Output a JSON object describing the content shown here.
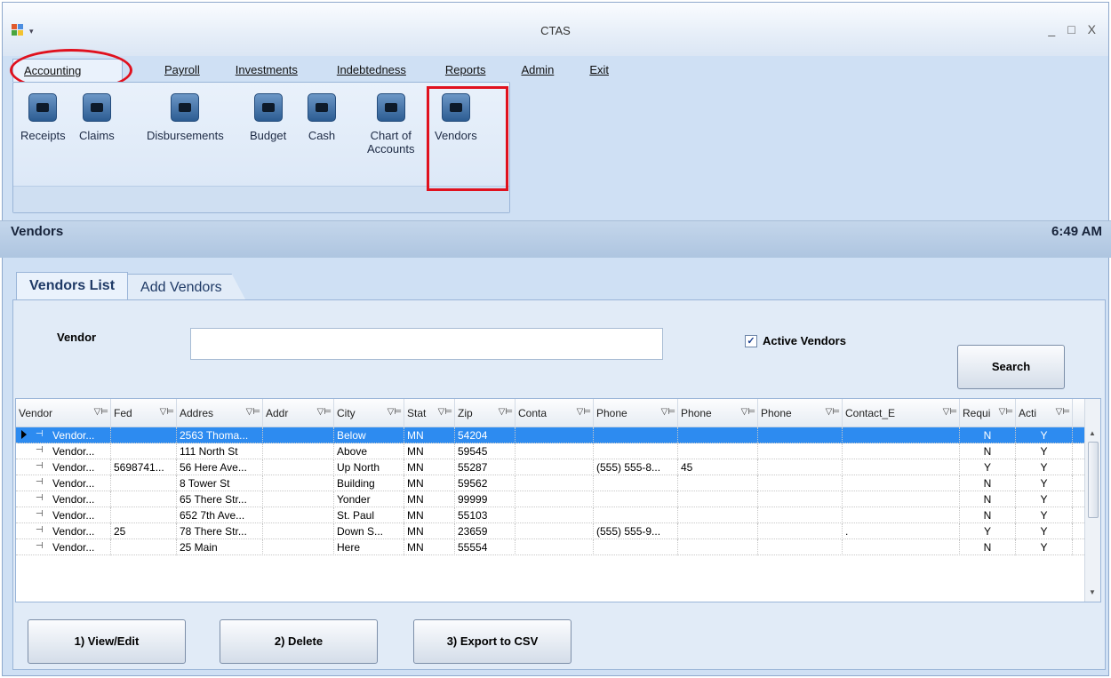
{
  "window": {
    "title": "CTAS",
    "controls": [
      "_",
      "□",
      "X"
    ]
  },
  "menu": [
    {
      "label": "Accounting",
      "active": true
    },
    {
      "label": "Payroll"
    },
    {
      "label": "Investments"
    },
    {
      "label": "Indebtedness"
    },
    {
      "label": "Reports"
    },
    {
      "label": "Admin"
    },
    {
      "label": "Exit"
    }
  ],
  "ribbon": {
    "buttons": [
      {
        "label": "Receipts",
        "icon": "receipts-icon"
      },
      {
        "label": "Claims",
        "icon": "claims-icon"
      },
      {
        "label": "Disbursements",
        "icon": "disbursements-icon"
      },
      {
        "label": "Budget",
        "icon": "budget-icon"
      },
      {
        "label": "Cash",
        "icon": "cash-icon"
      },
      {
        "label": "Chart of",
        "label2": "Accounts",
        "icon": "chart-of-accounts-icon"
      },
      {
        "label": "Vendors",
        "icon": "vendors-icon"
      }
    ]
  },
  "section": {
    "title": "Vendors",
    "time": "6:49 AM"
  },
  "tabs": [
    {
      "label": "Vendors List",
      "active": true
    },
    {
      "label": "Add Vendors"
    }
  ],
  "search": {
    "vendor_label": "Vendor",
    "vendor_value": "",
    "active_label": "Active Vendors",
    "active_checked": true,
    "check_mark": "✓",
    "search_button": "Search"
  },
  "grid": {
    "columns": [
      "Vendor",
      "Fed",
      "Addres",
      "Addr",
      "City",
      "Stat",
      "Zip",
      "Conta",
      "Phone",
      "Phone",
      "Phone",
      "Contact_E",
      "Requi",
      "Acti"
    ],
    "rows": [
      [
        "Vendor...",
        "",
        "2563 Thoma...",
        "",
        "Below",
        "MN",
        "54204",
        "",
        "",
        "",
        "",
        "",
        "N",
        "Y"
      ],
      [
        "Vendor...",
        "",
        "111 North St",
        "",
        "Above",
        "MN",
        "59545",
        "",
        "",
        "",
        "",
        "",
        "N",
        "Y"
      ],
      [
        "Vendor...",
        "5698741...",
        "56 Here Ave...",
        "",
        "Up North",
        "MN",
        "55287",
        "",
        "(555) 555-8...",
        "45",
        "",
        "",
        "Y",
        "Y"
      ],
      [
        "Vendor...",
        "",
        "8 Tower St",
        "",
        "Building",
        "MN",
        "59562",
        "",
        "",
        "",
        "",
        "",
        "N",
        "Y"
      ],
      [
        "Vendor...",
        "",
        "65 There Str...",
        "",
        "Yonder",
        "MN",
        "99999",
        "",
        "",
        "",
        "",
        "",
        "N",
        "Y"
      ],
      [
        "Vendor...",
        "",
        "652  7th Ave...",
        "",
        "St. Paul",
        "MN",
        "55103",
        "",
        "",
        "",
        "",
        "",
        "N",
        "Y"
      ],
      [
        "Vendor...",
        "25",
        "78 There Str...",
        "",
        "Down S...",
        "MN",
        "23659",
        "",
        "(555) 555-9...",
        "",
        "",
        ".",
        "Y",
        "Y"
      ],
      [
        "Vendor...",
        "",
        "25 Main",
        "",
        "Here",
        "MN",
        "55554",
        "",
        "",
        "",
        "",
        "",
        "N",
        "Y"
      ]
    ],
    "selected_row": 0
  },
  "actions": [
    {
      "label": "1) View/Edit"
    },
    {
      "label": "2) Delete"
    },
    {
      "label": "3) Export to CSV"
    }
  ],
  "annotations": {
    "highlight_color": "#e0111e"
  }
}
